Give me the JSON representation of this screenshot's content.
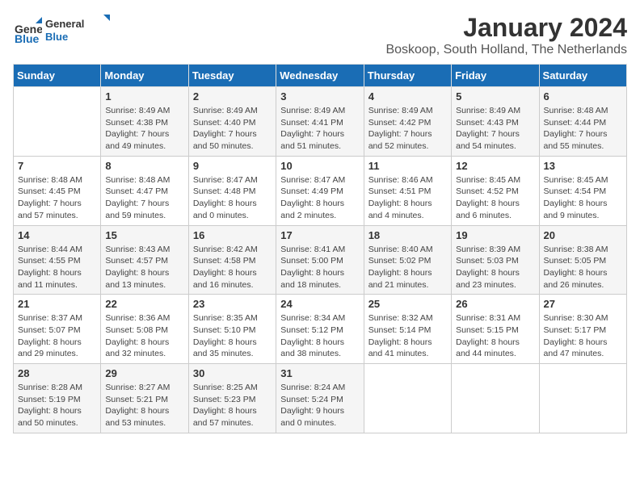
{
  "header": {
    "logo_text_general": "General",
    "logo_text_blue": "Blue",
    "month_year": "January 2024",
    "location": "Boskoop, South Holland, The Netherlands"
  },
  "days_of_week": [
    "Sunday",
    "Monday",
    "Tuesday",
    "Wednesday",
    "Thursday",
    "Friday",
    "Saturday"
  ],
  "weeks": [
    [
      {
        "day": "",
        "info": ""
      },
      {
        "day": "1",
        "info": "Sunrise: 8:49 AM\nSunset: 4:38 PM\nDaylight: 7 hours\nand 49 minutes."
      },
      {
        "day": "2",
        "info": "Sunrise: 8:49 AM\nSunset: 4:40 PM\nDaylight: 7 hours\nand 50 minutes."
      },
      {
        "day": "3",
        "info": "Sunrise: 8:49 AM\nSunset: 4:41 PM\nDaylight: 7 hours\nand 51 minutes."
      },
      {
        "day": "4",
        "info": "Sunrise: 8:49 AM\nSunset: 4:42 PM\nDaylight: 7 hours\nand 52 minutes."
      },
      {
        "day": "5",
        "info": "Sunrise: 8:49 AM\nSunset: 4:43 PM\nDaylight: 7 hours\nand 54 minutes."
      },
      {
        "day": "6",
        "info": "Sunrise: 8:48 AM\nSunset: 4:44 PM\nDaylight: 7 hours\nand 55 minutes."
      }
    ],
    [
      {
        "day": "7",
        "info": "Sunrise: 8:48 AM\nSunset: 4:45 PM\nDaylight: 7 hours\nand 57 minutes."
      },
      {
        "day": "8",
        "info": "Sunrise: 8:48 AM\nSunset: 4:47 PM\nDaylight: 7 hours\nand 59 minutes."
      },
      {
        "day": "9",
        "info": "Sunrise: 8:47 AM\nSunset: 4:48 PM\nDaylight: 8 hours\nand 0 minutes."
      },
      {
        "day": "10",
        "info": "Sunrise: 8:47 AM\nSunset: 4:49 PM\nDaylight: 8 hours\nand 2 minutes."
      },
      {
        "day": "11",
        "info": "Sunrise: 8:46 AM\nSunset: 4:51 PM\nDaylight: 8 hours\nand 4 minutes."
      },
      {
        "day": "12",
        "info": "Sunrise: 8:45 AM\nSunset: 4:52 PM\nDaylight: 8 hours\nand 6 minutes."
      },
      {
        "day": "13",
        "info": "Sunrise: 8:45 AM\nSunset: 4:54 PM\nDaylight: 8 hours\nand 9 minutes."
      }
    ],
    [
      {
        "day": "14",
        "info": "Sunrise: 8:44 AM\nSunset: 4:55 PM\nDaylight: 8 hours\nand 11 minutes."
      },
      {
        "day": "15",
        "info": "Sunrise: 8:43 AM\nSunset: 4:57 PM\nDaylight: 8 hours\nand 13 minutes."
      },
      {
        "day": "16",
        "info": "Sunrise: 8:42 AM\nSunset: 4:58 PM\nDaylight: 8 hours\nand 16 minutes."
      },
      {
        "day": "17",
        "info": "Sunrise: 8:41 AM\nSunset: 5:00 PM\nDaylight: 8 hours\nand 18 minutes."
      },
      {
        "day": "18",
        "info": "Sunrise: 8:40 AM\nSunset: 5:02 PM\nDaylight: 8 hours\nand 21 minutes."
      },
      {
        "day": "19",
        "info": "Sunrise: 8:39 AM\nSunset: 5:03 PM\nDaylight: 8 hours\nand 23 minutes."
      },
      {
        "day": "20",
        "info": "Sunrise: 8:38 AM\nSunset: 5:05 PM\nDaylight: 8 hours\nand 26 minutes."
      }
    ],
    [
      {
        "day": "21",
        "info": "Sunrise: 8:37 AM\nSunset: 5:07 PM\nDaylight: 8 hours\nand 29 minutes."
      },
      {
        "day": "22",
        "info": "Sunrise: 8:36 AM\nSunset: 5:08 PM\nDaylight: 8 hours\nand 32 minutes."
      },
      {
        "day": "23",
        "info": "Sunrise: 8:35 AM\nSunset: 5:10 PM\nDaylight: 8 hours\nand 35 minutes."
      },
      {
        "day": "24",
        "info": "Sunrise: 8:34 AM\nSunset: 5:12 PM\nDaylight: 8 hours\nand 38 minutes."
      },
      {
        "day": "25",
        "info": "Sunrise: 8:32 AM\nSunset: 5:14 PM\nDaylight: 8 hours\nand 41 minutes."
      },
      {
        "day": "26",
        "info": "Sunrise: 8:31 AM\nSunset: 5:15 PM\nDaylight: 8 hours\nand 44 minutes."
      },
      {
        "day": "27",
        "info": "Sunrise: 8:30 AM\nSunset: 5:17 PM\nDaylight: 8 hours\nand 47 minutes."
      }
    ],
    [
      {
        "day": "28",
        "info": "Sunrise: 8:28 AM\nSunset: 5:19 PM\nDaylight: 8 hours\nand 50 minutes."
      },
      {
        "day": "29",
        "info": "Sunrise: 8:27 AM\nSunset: 5:21 PM\nDaylight: 8 hours\nand 53 minutes."
      },
      {
        "day": "30",
        "info": "Sunrise: 8:25 AM\nSunset: 5:23 PM\nDaylight: 8 hours\nand 57 minutes."
      },
      {
        "day": "31",
        "info": "Sunrise: 8:24 AM\nSunset: 5:24 PM\nDaylight: 9 hours\nand 0 minutes."
      },
      {
        "day": "",
        "info": ""
      },
      {
        "day": "",
        "info": ""
      },
      {
        "day": "",
        "info": ""
      }
    ]
  ]
}
